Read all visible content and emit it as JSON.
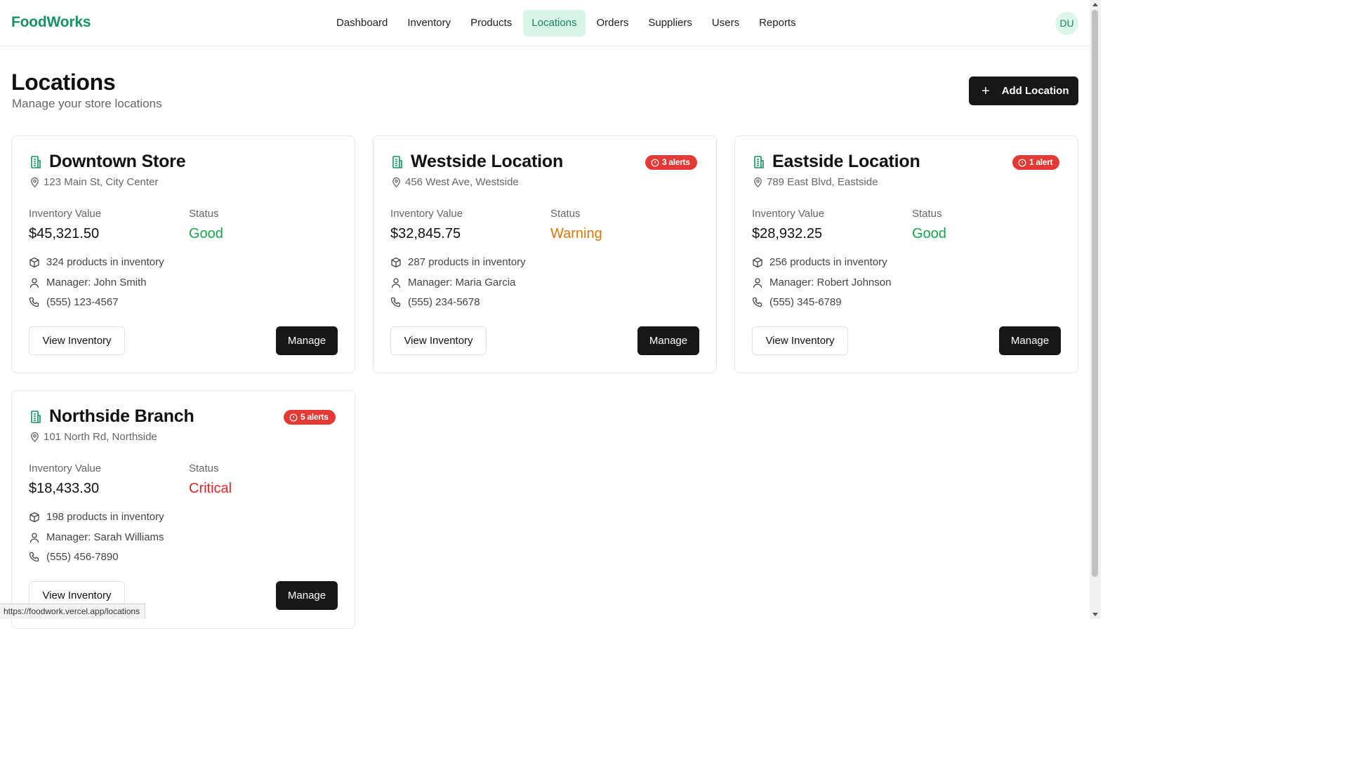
{
  "app": {
    "brand": "FoodWorks",
    "avatar_initials": "DU"
  },
  "nav": {
    "items": [
      {
        "label": "Dashboard"
      },
      {
        "label": "Inventory"
      },
      {
        "label": "Products"
      },
      {
        "label": "Locations",
        "active": true
      },
      {
        "label": "Orders"
      },
      {
        "label": "Suppliers"
      },
      {
        "label": "Users"
      },
      {
        "label": "Reports"
      }
    ]
  },
  "page": {
    "title": "Locations",
    "subtitle": "Manage your store locations",
    "add_button_label": "Add Location"
  },
  "labels": {
    "inventory_value": "Inventory Value",
    "status": "Status",
    "view_inventory": "View Inventory",
    "manage": "Manage"
  },
  "locations": [
    {
      "name": "Downtown Store",
      "address": "123 Main St, City Center",
      "badge": "",
      "inventory_value": "$45,321.50",
      "status": "Good",
      "products": "324 products in inventory",
      "manager": "Manager: John Smith",
      "phone": "(555) 123-4567"
    },
    {
      "name": "Westside Location",
      "address": "456 West Ave, Westside",
      "badge": "3 alerts",
      "inventory_value": "$32,845.75",
      "status": "Warning",
      "products": "287 products in inventory",
      "manager": "Manager: Maria Garcia",
      "phone": "(555) 234-5678"
    },
    {
      "name": "Eastside Location",
      "address": "789 East Blvd, Eastside",
      "badge": "1 alert",
      "inventory_value": "$28,932.25",
      "status": "Good",
      "products": "256 products in inventory",
      "manager": "Manager: Robert Johnson",
      "phone": "(555) 345-6789"
    },
    {
      "name": "Northside Branch",
      "address": "101 North Rd, Northside",
      "badge": "5 alerts",
      "inventory_value": "$18,433.30",
      "status": "Critical",
      "products": "198 products in inventory",
      "manager": "Manager: Sarah Williams",
      "phone": "(555) 456-7890"
    }
  ],
  "colors": {
    "brand": "#15935f",
    "active_nav_bg": "#d9f5e8",
    "status_good": "#16a34a",
    "status_warning": "#d97706",
    "status_critical": "#dc2626",
    "alert_badge": "#e53935",
    "primary_button": "#171717"
  },
  "icons": {
    "location_card": "building-icon",
    "address": "map-pin-icon",
    "products": "package-icon",
    "manager": "user-icon",
    "phone": "phone-icon",
    "badge": "alert-circle-icon",
    "add": "plus-icon"
  },
  "status_url": "https://foodwork.vercel.app/locations"
}
